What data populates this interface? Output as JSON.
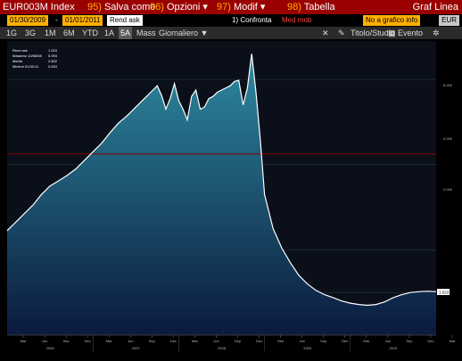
{
  "toolbar": {
    "ticker": "EUR003M Index",
    "actions": [
      {
        "num": "95)",
        "label": "Salva come"
      },
      {
        "num": "96)",
        "label": "Opzioni ▾"
      },
      {
        "num": "97)",
        "label": "Modif ▾"
      },
      {
        "num": "98)",
        "label": "Tabella"
      }
    ],
    "view_label": "Graf Linea"
  },
  "params": {
    "start_date": "01/30/2009",
    "end_date": "01/01/2011",
    "field": "Rend ask",
    "compare": "1) Confronta",
    "compare_value": "Med mob",
    "info_dropdown": "No a grafico info",
    "currency": "EUR"
  },
  "periods": [
    "1G",
    "3G",
    "1M",
    "6M",
    "YTD",
    "1A",
    "5A",
    "Mass"
  ],
  "selected_period": "5A",
  "frequency": "Giornaliero ▼",
  "right_tools": [
    "Titolo/Studio",
    "Evento"
  ],
  "legend": {
    "items": [
      {
        "label": "Rend ask",
        "value": "1.024"
      },
      {
        "label": "Massimo 10/08/08",
        "value": "5.393"
      },
      {
        "label": "Media",
        "value": "2.802"
      },
      {
        "label": "Minimo 01/31/11",
        "value": "0.634"
      }
    ]
  },
  "colors": {
    "toolbar_bg": "#9a0000",
    "accent_orange": "#ffb000",
    "line": "#ffffff",
    "area_top": "#2e8aa0",
    "area_bottom": "#0b1a3e",
    "reference_line": "#8b0000"
  },
  "chart_data": {
    "type": "area",
    "title": "",
    "xlabel": "",
    "ylabel": "",
    "y_ticks": [
      "6.000",
      "4.000",
      "2.000"
    ],
    "last_value": "1.023",
    "x_tick_labels": [
      "Mar",
      "Jun",
      "Sep",
      "Dec",
      "Mar",
      "Jun",
      "Sep",
      "Dec",
      "Mar",
      "Jun",
      "Sep",
      "Dec",
      "Mar",
      "Jun",
      "Sep",
      "Dec",
      "Mar",
      "Jun",
      "Sep",
      "Dec",
      "Mar",
      "Jun",
      "Sep",
      "Dec"
    ],
    "year_labels": [
      "2006",
      "2007",
      "2008",
      "2009",
      "2010"
    ],
    "x_range": [
      0,
      5
    ],
    "ylim": [
      0,
      6.9
    ],
    "reference_line": 4.25,
    "x": [
      0.0,
      0.1,
      0.2,
      0.3,
      0.4,
      0.5,
      0.6,
      0.7,
      0.8,
      0.9,
      1.0,
      1.1,
      1.2,
      1.3,
      1.4,
      1.5,
      1.6,
      1.7,
      1.75,
      1.8,
      1.85,
      1.9,
      1.95,
      2.0,
      2.05,
      2.1,
      2.15,
      2.2,
      2.25,
      2.3,
      2.35,
      2.4,
      2.45,
      2.5,
      2.55,
      2.6,
      2.65,
      2.7,
      2.75,
      2.8,
      2.85,
      2.9,
      2.95,
      3.0,
      3.1,
      3.2,
      3.3,
      3.4,
      3.5,
      3.6,
      3.7,
      3.8,
      3.9,
      4.0,
      4.1,
      4.2,
      4.3,
      4.4,
      4.5,
      4.6,
      4.7,
      4.8,
      4.9,
      5.0
    ],
    "values": [
      2.45,
      2.65,
      2.85,
      3.05,
      3.3,
      3.5,
      3.62,
      3.75,
      3.9,
      4.1,
      4.3,
      4.5,
      4.75,
      4.98,
      5.15,
      5.35,
      5.55,
      5.75,
      5.85,
      5.62,
      5.3,
      5.55,
      5.9,
      5.5,
      5.3,
      5.05,
      5.6,
      5.75,
      5.3,
      5.35,
      5.55,
      5.6,
      5.7,
      5.75,
      5.8,
      5.85,
      5.95,
      5.98,
      5.4,
      5.8,
      6.6,
      5.7,
      4.6,
      3.3,
      2.5,
      2.05,
      1.7,
      1.4,
      1.2,
      1.05,
      0.95,
      0.88,
      0.8,
      0.75,
      0.72,
      0.7,
      0.72,
      0.78,
      0.88,
      0.95,
      1.0,
      1.02,
      1.03,
      1.02
    ]
  }
}
